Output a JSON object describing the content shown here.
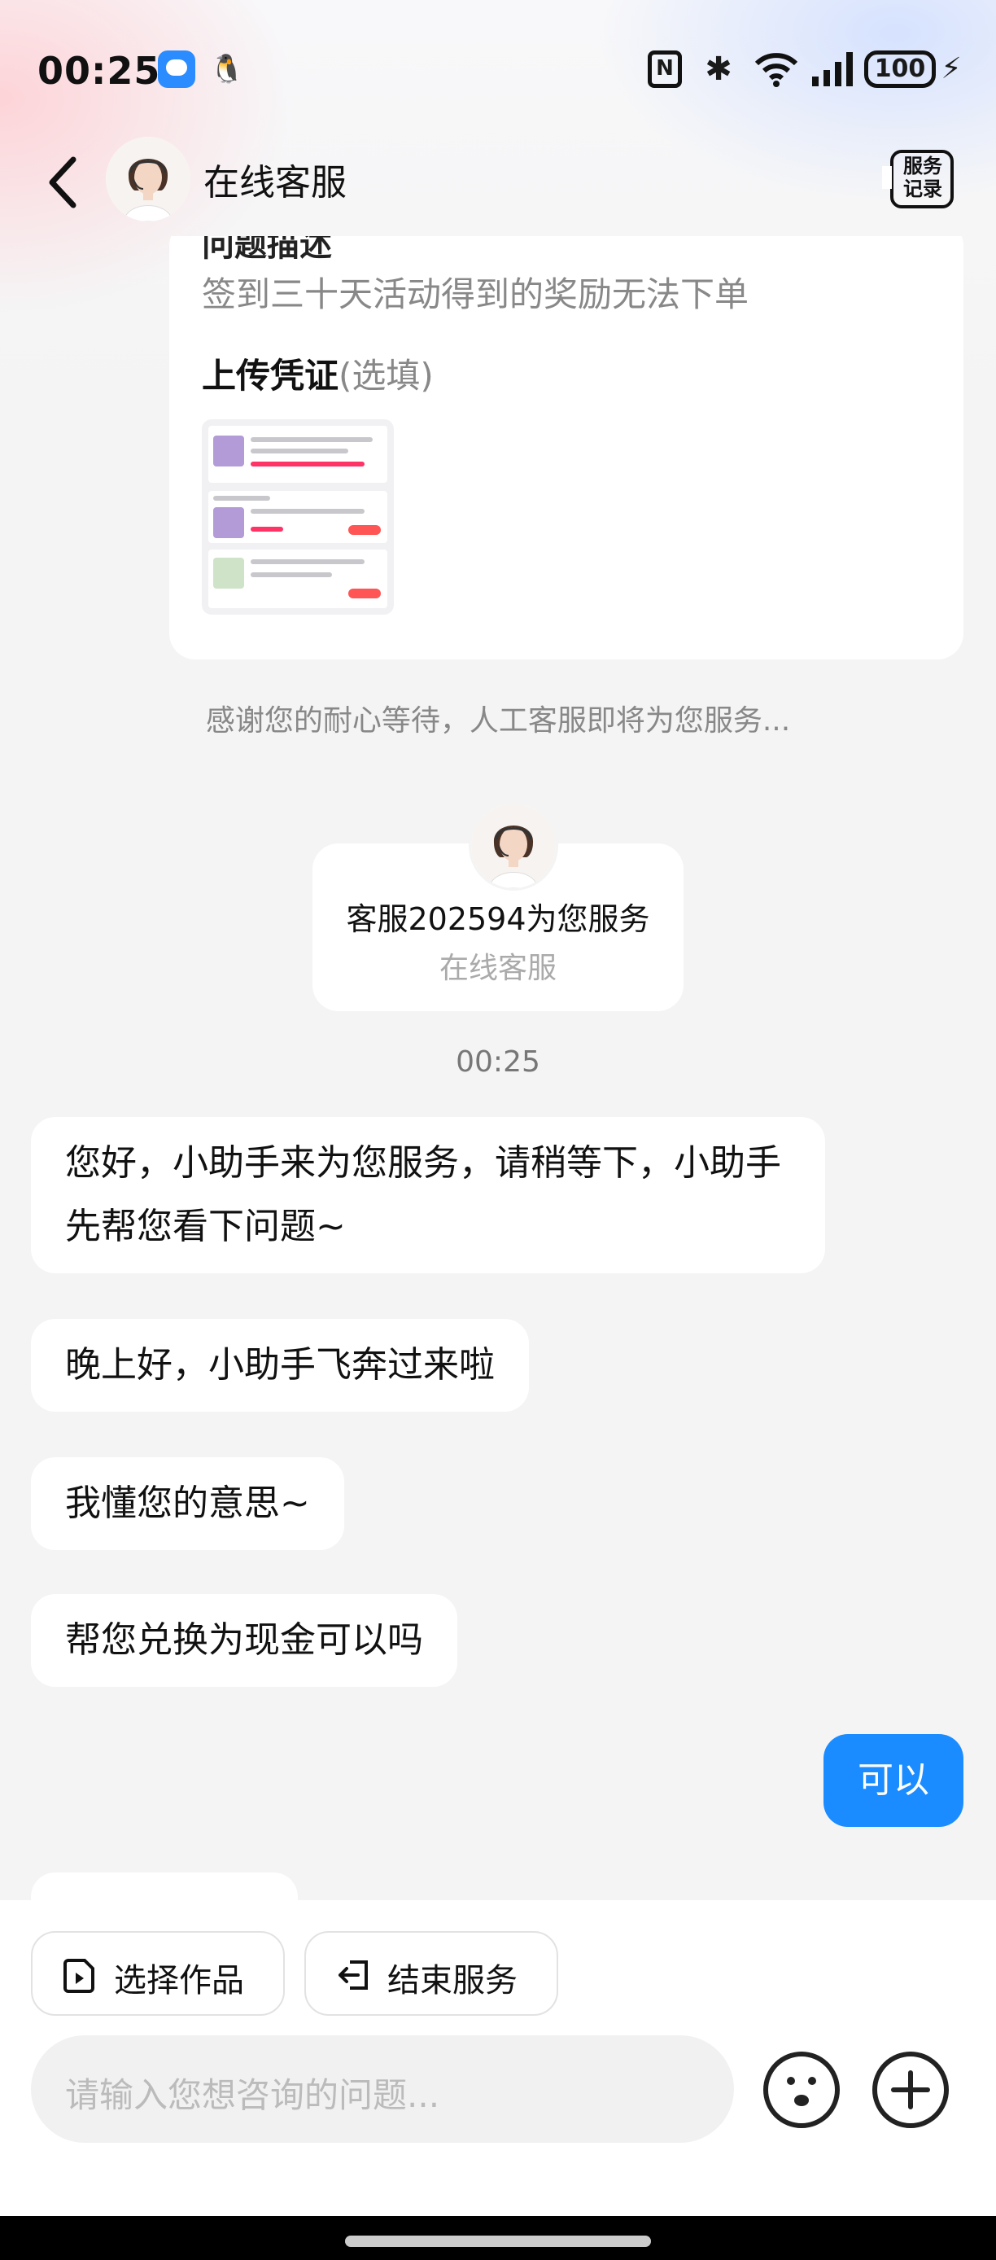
{
  "status_bar": {
    "time": "00:25",
    "qq_glyph": "🐧",
    "nfc_label": "N",
    "bluetooth_glyph": "✱",
    "battery": "100",
    "bolt_glyph": "⚡"
  },
  "header": {
    "back_icon": "chevron-left-icon",
    "title": "在线客服",
    "service_records_line1": "服务",
    "service_records_line2": "记录"
  },
  "form_card": {
    "field_label": "问题描述",
    "description": "签到三十天活动得到的奖励无法下单",
    "upload_label": "上传凭证",
    "upload_optional": "(选填)"
  },
  "system_message": "感谢您的耐心等待，人工客服即将为您服务...",
  "agent": {
    "name": "客服202594为您服务",
    "role": "在线客服"
  },
  "timestamp": "00:25",
  "messages": [
    {
      "from": "agent",
      "text": "您好，小助手来为您服务，请稍等下，小助手先帮您看下问题~"
    },
    {
      "from": "agent",
      "text": "晚上好，小助手飞奔过来啦"
    },
    {
      "from": "agent",
      "text": "我懂您的意思~"
    },
    {
      "from": "agent",
      "text": "帮您兑换为现金可以吗"
    },
    {
      "from": "user",
      "text": "可以"
    }
  ],
  "quick_actions": {
    "select_work": "选择作品",
    "end_service": "结束服务"
  },
  "input": {
    "placeholder": "请输入您想咨询的问题..."
  },
  "colors": {
    "accent": "#1a8cff",
    "background": "#f4f4f4",
    "bubble": "#ffffff"
  }
}
